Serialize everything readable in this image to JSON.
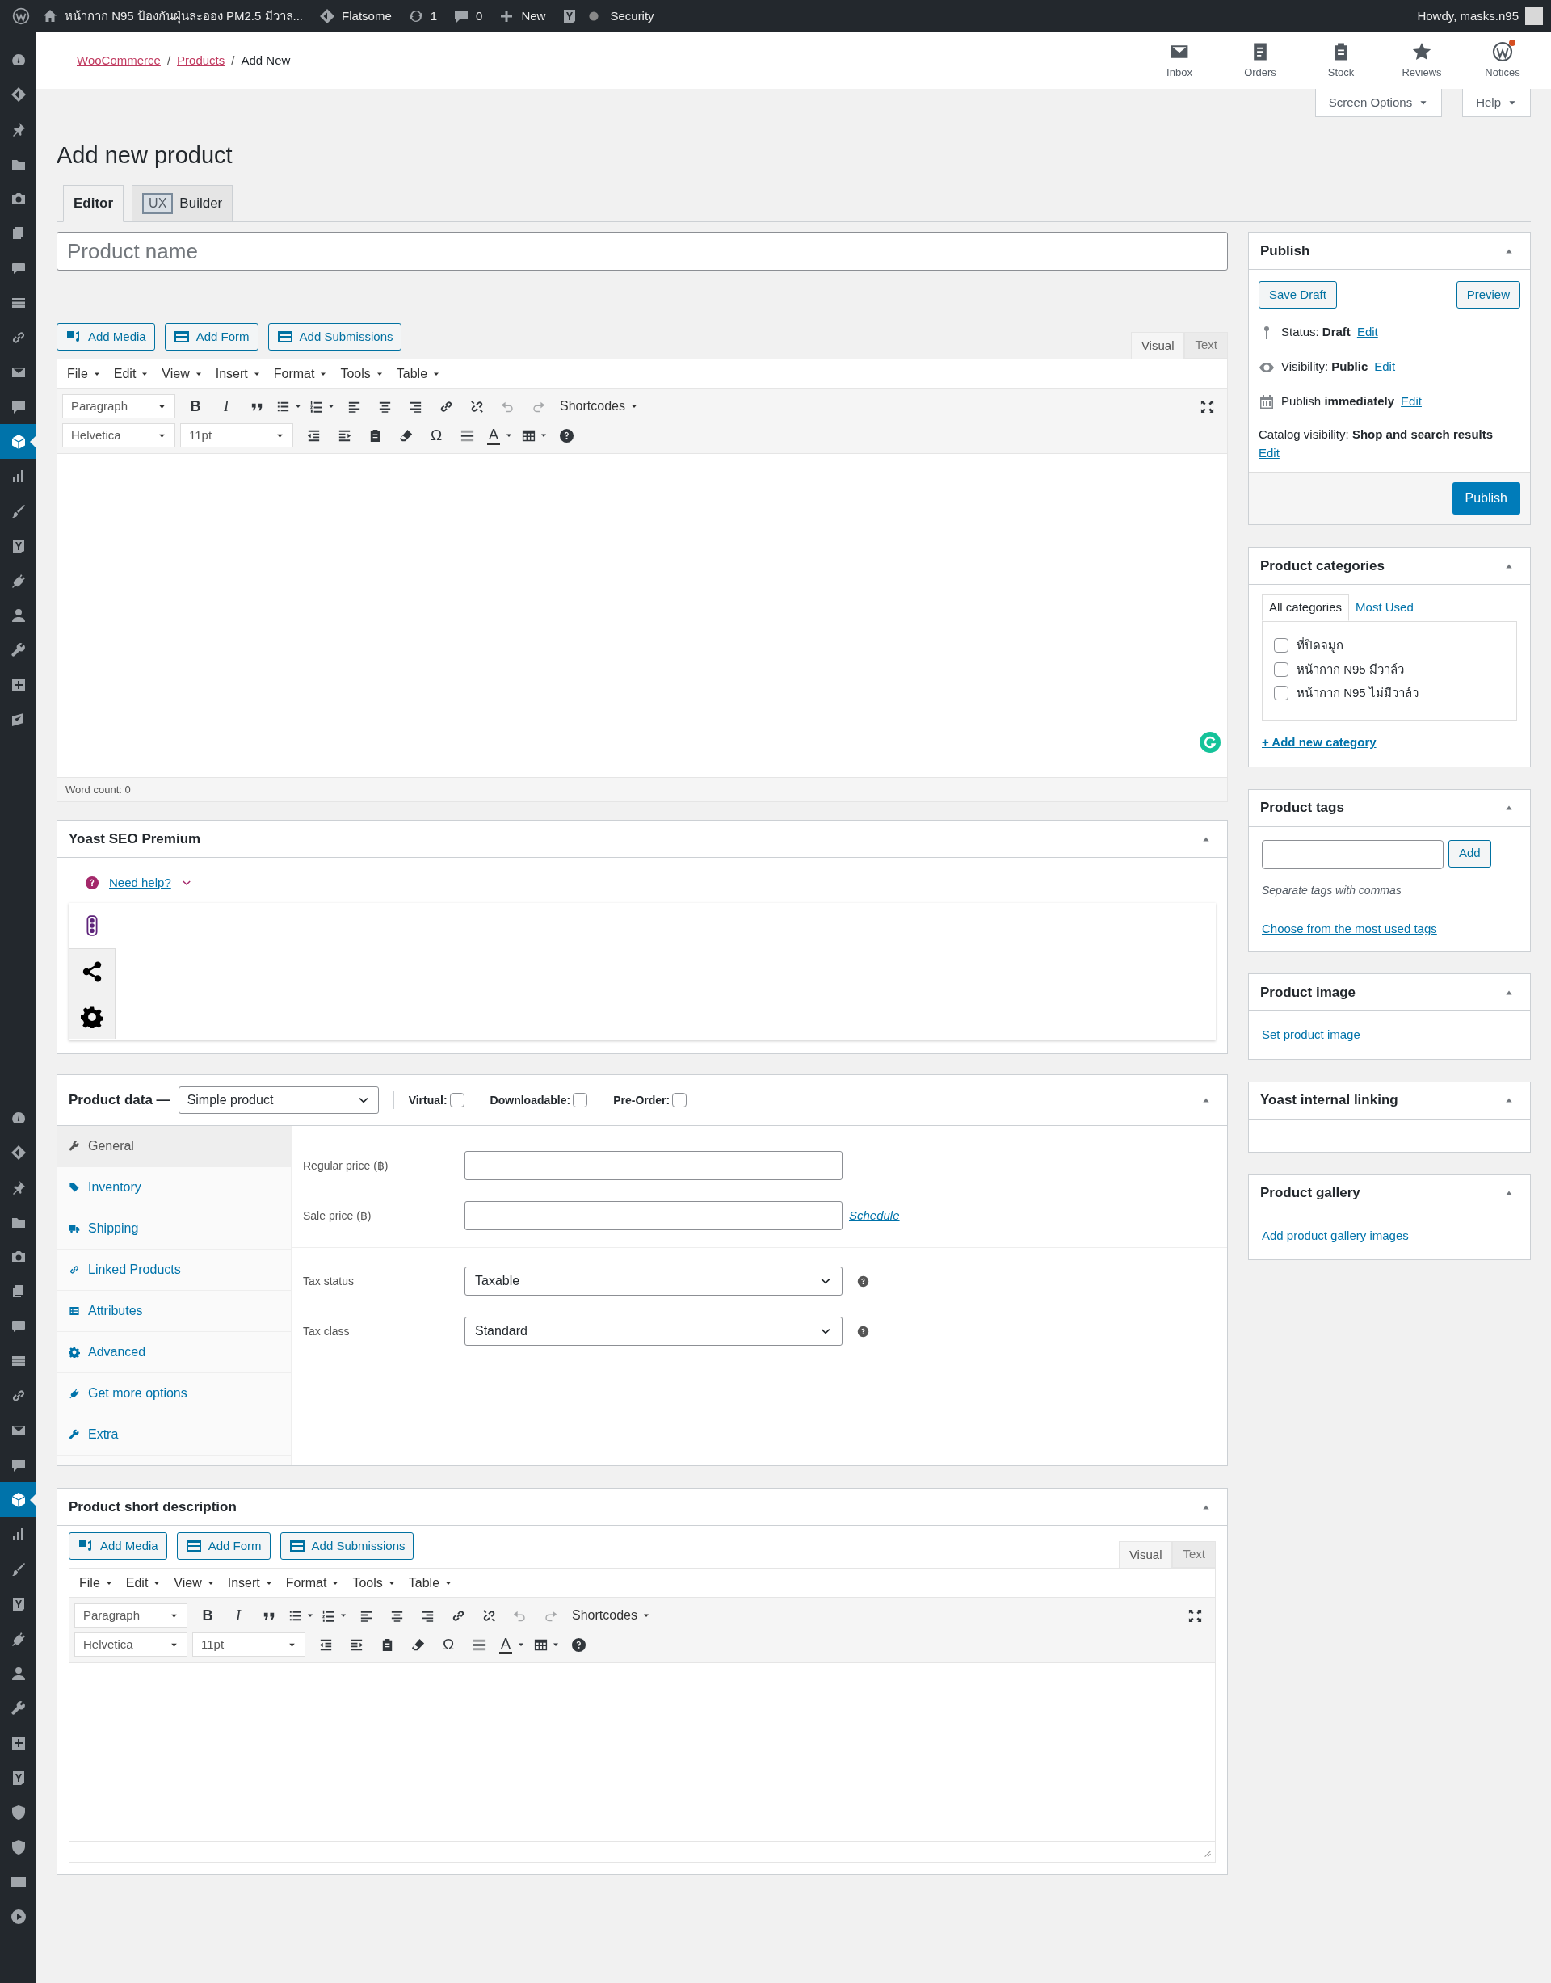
{
  "admin_bar": {
    "site_title": "หน้ากาก N95 ป้องกันฝุ่นละออง PM2.5 มีวาล...",
    "theme": "Flatsome",
    "updates": "1",
    "comments": "0",
    "new": "New",
    "security": "Security",
    "greeting": "Howdy, masks.n95"
  },
  "admin_menu": [
    {
      "selected": false
    },
    {
      "selected": false
    },
    {
      "selected": false
    },
    {
      "selected": false
    },
    {
      "selected": false
    },
    {
      "selected": false
    },
    {
      "selected": false
    },
    {
      "selected": false
    },
    {
      "selected": false
    },
    {
      "selected": false
    },
    {
      "selected": false
    },
    {
      "selected": true
    },
    {
      "selected": false
    },
    {
      "selected": false
    },
    {
      "selected": false
    },
    {
      "selected": false
    },
    {
      "selected": false
    },
    {
      "selected": false
    },
    {
      "selected": false
    },
    {
      "selected": false
    },
    {
      "selected": false
    },
    {
      "selected": false
    },
    {
      "selected": false
    },
    {
      "selected": false
    },
    {
      "selected": false
    },
    {
      "selected": false
    },
    {
      "selected": false
    },
    {
      "selected": false
    },
    {
      "selected": false
    },
    {
      "selected": false
    },
    {
      "selected": false
    },
    {
      "selected": true
    },
    {
      "selected": false
    },
    {
      "selected": false
    },
    {
      "selected": false
    },
    {
      "selected": false
    },
    {
      "selected": false
    },
    {
      "selected": false
    },
    {
      "selected": false
    },
    {
      "selected": false
    },
    {
      "selected": false
    },
    {
      "selected": false
    },
    {
      "selected": false
    },
    {
      "selected": false
    }
  ],
  "breadcrumbs": [
    {
      "kind": "link",
      "label": "WooCommerce"
    },
    {
      "kind": "separator",
      "label": "/"
    },
    {
      "kind": "link",
      "label": "Products"
    },
    {
      "kind": "separator",
      "label": "/"
    },
    {
      "kind": "current",
      "label": "Add New"
    }
  ],
  "activity": [
    {
      "label": "Inbox",
      "alert": false
    },
    {
      "label": "Orders",
      "alert": false
    },
    {
      "label": "Stock",
      "alert": false
    },
    {
      "label": "Reviews",
      "alert": false
    },
    {
      "label": "Notices",
      "alert": true
    }
  ],
  "screen_tabs": [
    "Screen Options",
    "Help"
  ],
  "page_title": "Add new product",
  "editor_tabs": [
    {
      "label": "Editor",
      "selected": true
    },
    {
      "badge": "UX",
      "label": "Builder",
      "selected": false
    }
  ],
  "product_name": {
    "placeholder": "Product name"
  },
  "description_editor": {
    "media_buttons": [
      "Add Media",
      "Add Form",
      "Add Submissions"
    ],
    "mode_tabs": [
      {
        "label": "Visual",
        "selected": true
      },
      {
        "label": "Text",
        "selected": false
      }
    ],
    "menus": [
      "File",
      "Edit",
      "View",
      "Insert",
      "Format",
      "Tools",
      "Table"
    ],
    "block_format": "Paragraph",
    "bold": "B",
    "italic": "I",
    "shortcodes": "Shortcodes",
    "font_family": "Helvetica",
    "font_size": "11pt",
    "special_char": "Ω",
    "text_color": "A",
    "word_count": "Word count: 0"
  },
  "yoast": {
    "title": "Yoast SEO Premium",
    "help": "Need help?",
    "tabs": [
      {
        "selected": true
      },
      {
        "selected": false
      },
      {
        "selected": false
      }
    ]
  },
  "product_data": {
    "title": "Product data —",
    "type": "Simple product",
    "options": [
      {
        "label": "Virtual:",
        "checked": false
      },
      {
        "label": "Downloadable:",
        "checked": false
      },
      {
        "label": "Pre-Order:",
        "checked": false
      }
    ],
    "tabs": [
      {
        "label": "General",
        "selected": true
      },
      {
        "label": "Inventory",
        "selected": false
      },
      {
        "label": "Shipping",
        "selected": false
      },
      {
        "label": "Linked Products",
        "selected": false
      },
      {
        "label": "Attributes",
        "selected": false
      },
      {
        "label": "Advanced",
        "selected": false
      },
      {
        "label": "Get more options",
        "selected": false
      },
      {
        "label": "Extra",
        "selected": false
      }
    ],
    "fields": [
      {
        "kind": "input",
        "label": "Regular price (฿)"
      },
      {
        "kind": "input",
        "label": "Sale price (฿)",
        "link": "Schedule"
      },
      {
        "kind": "select",
        "label": "Tax status",
        "value": "Taxable"
      },
      {
        "kind": "select",
        "label": "Tax class",
        "value": "Standard"
      }
    ]
  },
  "short_description": {
    "title": "Product short description",
    "editor": {
      "media_buttons": [
        "Add Media",
        "Add Form",
        "Add Submissions"
      ],
      "mode_tabs": [
        {
          "label": "Visual",
          "selected": true
        },
        {
          "label": "Text",
          "selected": false
        }
      ],
      "menus": [
        "File",
        "Edit",
        "View",
        "Insert",
        "Format",
        "Tools",
        "Table"
      ],
      "block_format": "Paragraph",
      "bold": "B",
      "italic": "I",
      "shortcodes": "Shortcodes",
      "font_family": "Helvetica",
      "font_size": "11pt",
      "special_char": "Ω",
      "text_color": "A"
    }
  },
  "publish": {
    "title": "Publish",
    "save_draft": "Save Draft",
    "preview": "Preview",
    "rows": [
      {
        "text": "Status: **Draft**",
        "edit": "Edit"
      },
      {
        "text": "Visibility: **Public**",
        "edit": "Edit"
      },
      {
        "text": "Publish **immediately**",
        "edit": "Edit"
      }
    ],
    "catalog": "Catalog visibility: **Shop and search results**",
    "catalog_edit": "Edit",
    "button": "Publish"
  },
  "categories": {
    "title": "Product categories",
    "tabs": [
      {
        "label": "All categories",
        "selected": true
      },
      {
        "label": "Most Used",
        "selected": false
      }
    ],
    "items": [
      {
        "label": "ที่ปิดจมูก",
        "checked": false
      },
      {
        "label": "หน้ากาก N95 มีวาล์ว",
        "checked": false
      },
      {
        "label": "หน้ากาก N95 ไม่มีวาล์ว",
        "checked": false
      }
    ],
    "add": "+ Add new category"
  },
  "tags": {
    "title": "Product tags",
    "button": "Add",
    "hint": "Separate tags with commas",
    "link": "Choose from the most used tags"
  },
  "product_image": {
    "title": "Product image",
    "link": "Set product image"
  },
  "internal_linking": {
    "title": "Yoast internal linking"
  },
  "gallery": {
    "title": "Product gallery",
    "link": "Add product gallery images"
  }
}
